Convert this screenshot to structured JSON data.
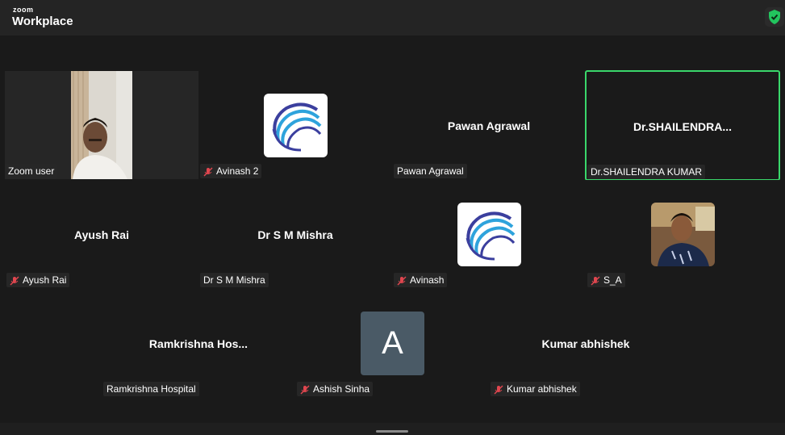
{
  "app": {
    "brand_small": "zoom",
    "brand_large": "Workplace"
  },
  "participants": [
    {
      "name": "Zoom user",
      "display": "video",
      "muted": false
    },
    {
      "name": "Avinash 2",
      "display": "logo",
      "muted": true
    },
    {
      "name": "Pawan Agrawal",
      "display_name": "Pawan Agrawal",
      "muted": false
    },
    {
      "name": "Dr.SHAILENDRA KUMAR",
      "display_name": "Dr.SHAILENDRA...",
      "muted": false,
      "active_speaker": true
    },
    {
      "name": "Ayush Rai",
      "display_name": "Ayush Rai",
      "muted": true
    },
    {
      "name": "Dr S M Mishra",
      "display_name": "Dr S M Mishra",
      "muted": false
    },
    {
      "name": "Avinash",
      "display": "logo",
      "muted": true
    },
    {
      "name": "S_A",
      "display": "photo",
      "muted": true
    },
    {
      "name": "Ramkrishna Hospital",
      "display_name": "Ramkrishna  Hos...",
      "muted": false
    },
    {
      "name": "Ashish Sinha",
      "display": "letter",
      "letter": "A",
      "muted": true
    },
    {
      "name": "Kumar abhishek",
      "display_name": "Kumar abhishek",
      "muted": true
    }
  ],
  "colors": {
    "active_border": "#3ad76b",
    "muted_mic": "#e0464f",
    "background": "#1a1a1a"
  }
}
